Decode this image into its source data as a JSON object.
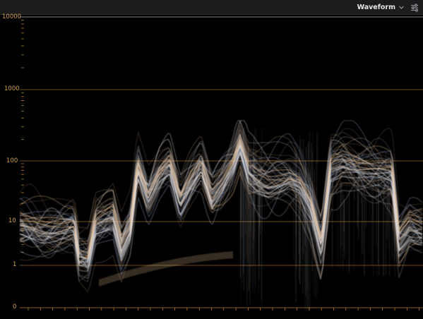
{
  "header": {
    "title": "Waveform",
    "chevron_icon": "chevron-down-icon",
    "settings_icon": "sliders-icon"
  },
  "scale": {
    "labels": [
      "10000",
      "1000",
      "100",
      "10",
      "1",
      "0"
    ],
    "grid_color": "#c8892e",
    "label_color": "#d3a24a"
  },
  "colors": {
    "background": "#000000",
    "header_bg": "#1c1c1e",
    "trace": "#e8e8ec",
    "trace_warm": "#f2c89a",
    "trace_cool": "#b8cdf2"
  }
}
